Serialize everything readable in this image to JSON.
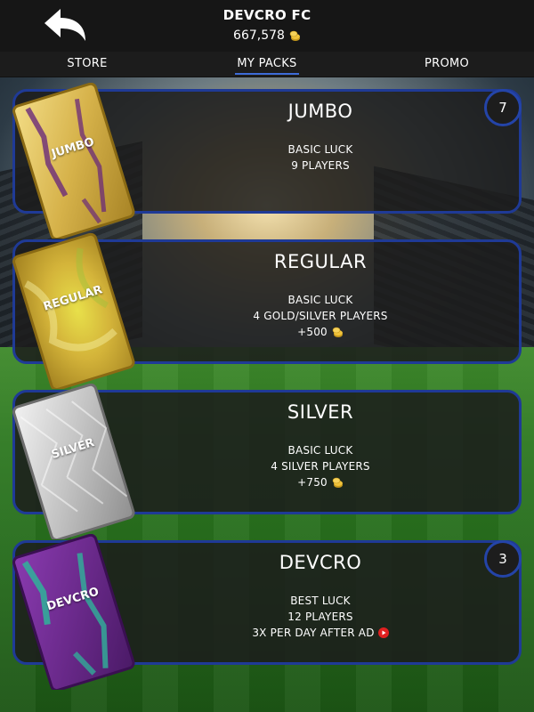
{
  "header": {
    "club_name": "DEVCRO FC",
    "coins": "667,578",
    "back_icon": "back-arrow-icon",
    "coin_icon": "coin-icon"
  },
  "tabs": [
    {
      "label": "STORE",
      "active": false
    },
    {
      "label": "MY PACKS",
      "active": true
    },
    {
      "label": "PROMO",
      "active": false
    }
  ],
  "colors": {
    "accent_blue": "#2444a8",
    "gold": "#d4b24a",
    "silver": "#c8c8c8",
    "purple": "#6b2a8c",
    "teal": "#2fb39a"
  },
  "packs": [
    {
      "title": "JUMBO",
      "card_label": "JUMBO",
      "line1": "BASIC LUCK",
      "line2": "9 PLAYERS",
      "line3": "",
      "badge": "7"
    },
    {
      "title": "REGULAR",
      "card_label": "REGULAR",
      "line1": "BASIC LUCK",
      "line2": "4 GOLD/SILVER PLAYERS",
      "line3": "+500",
      "badge": ""
    },
    {
      "title": "SILVER",
      "card_label": "SILVER",
      "line1": "BASIC LUCK",
      "line2": "4  SILVER PLAYERS",
      "line3": "+750",
      "badge": ""
    },
    {
      "title": "DEVCRO",
      "card_label": "DEVCRO",
      "line1": "BEST LUCK",
      "line2": "12 PLAYERS",
      "line3": "3X PER DAY AFTER AD",
      "badge": "3"
    }
  ]
}
